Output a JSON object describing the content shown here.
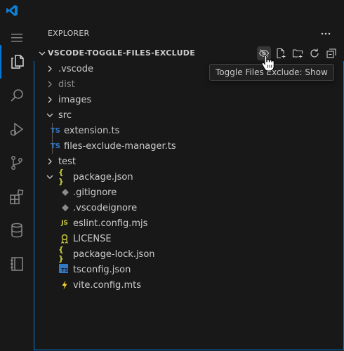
{
  "sidebar": {
    "title": "EXPLORER",
    "section_title": "VSCODE-TOGGLE-FILES-EXCLUDE"
  },
  "tooltip": "Toggle Files Exclude: Show",
  "tree": [
    {
      "label": ".vscode",
      "kind": "folder",
      "state": "collapsed"
    },
    {
      "label": "dist",
      "kind": "folder",
      "state": "collapsed",
      "dimmed": true
    },
    {
      "label": "images",
      "kind": "folder",
      "state": "collapsed"
    },
    {
      "label": "src",
      "kind": "folder",
      "state": "expanded"
    },
    {
      "label": "extension.ts",
      "kind": "ts"
    },
    {
      "label": "files-exclude-manager.ts",
      "kind": "ts"
    },
    {
      "label": "test",
      "kind": "folder",
      "state": "collapsed"
    },
    {
      "label": "package.json",
      "kind": "json",
      "icon_text": "{ }"
    },
    {
      "label": ".gitignore",
      "kind": "git"
    },
    {
      "label": ".vscodeignore",
      "kind": "git"
    },
    {
      "label": "eslint.config.mjs",
      "kind": "js",
      "icon_text": "JS"
    },
    {
      "label": "LICENSE",
      "kind": "license"
    },
    {
      "label": "package-lock.json",
      "kind": "json",
      "icon_text": "{ }"
    },
    {
      "label": "tsconfig.json",
      "kind": "tsconfig",
      "icon_text": "TS"
    },
    {
      "label": "vite.config.mts",
      "kind": "vite"
    }
  ],
  "ts_icon_text": "TS",
  "colors": {
    "accent": "#0078d4",
    "ts": "#3178c6",
    "json": "#cbcb41",
    "js": "#cbcb41",
    "git": "#8a8a8a",
    "license": "#cbcb41",
    "vite": "#ffd62e"
  }
}
